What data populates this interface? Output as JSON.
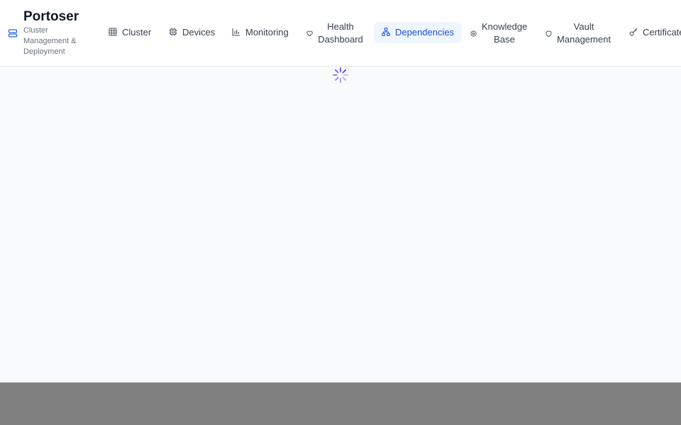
{
  "brand": {
    "title": "Portoser",
    "subtitle": "Cluster Management & Deployment",
    "icon": "server-stack-icon"
  },
  "nav": {
    "items": [
      {
        "label": "Cluster",
        "icon": "grid-icon"
      },
      {
        "label": "Devices",
        "icon": "cpu-icon"
      },
      {
        "label": "Monitoring",
        "icon": "bar-chart-icon"
      },
      {
        "label": "Health Dashboard",
        "icon": "heart-icon"
      },
      {
        "label": "Dependencies",
        "icon": "network-icon",
        "active": true
      },
      {
        "label": "Knowledge Base",
        "icon": "brain-icon"
      },
      {
        "label": "Vault Management",
        "icon": "shield-icon"
      },
      {
        "label": "Certificate",
        "icon": "key-icon"
      }
    ]
  },
  "main": {
    "status": "loading",
    "spinner_icon": "loading-spinner-icon"
  },
  "colors": {
    "accent": "#1d4ed8",
    "active_bg": "#eff6ff",
    "spinner": "#4f46e5",
    "content_bg": "#f9fafb",
    "overlay": "#808080"
  }
}
